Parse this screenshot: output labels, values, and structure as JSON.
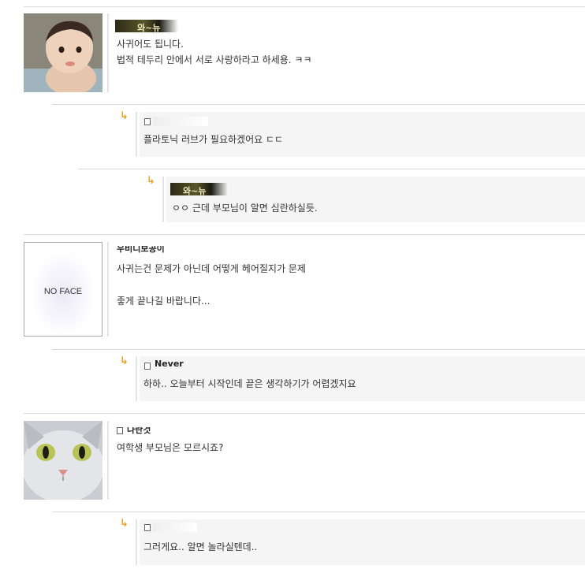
{
  "comments": [
    {
      "author": "와~뉴",
      "lines": [
        "사귀어도 됩니다.",
        "법적 테두리 안에서 서로 사랑하라고 하세용. ㅋㅋ"
      ],
      "replies": [
        {
          "author": "",
          "text": "플라토닉 러브가 필요하겠어요 ㄷㄷ"
        },
        {
          "author": "와~뉴",
          "text": "ㅇㅇ 근데 부모님이 알면 심란하실듯."
        }
      ]
    },
    {
      "author": "우비디보공이",
      "avatar_label": "NO FACE",
      "lines": [
        "사귀는건 문제가 아닌데 어떻게 헤어질지가 문제",
        "좋게 끝나길 바랍니다..."
      ],
      "replies": [
        {
          "author": "Never",
          "text": "하하.. 오늘부터 시작인데 끝은 생각하기가 어렵겠지요"
        }
      ]
    },
    {
      "author": "나란것",
      "lines": [
        "여학생 부모님은 모르시죠?"
      ],
      "replies": [
        {
          "author": "",
          "text": "그러게요.. 알면 놀라실텐데.."
        }
      ]
    }
  ],
  "colors": {
    "reply_arrow": "#e8a22a",
    "reply_bg": "#f5f5f5",
    "divider": "#dcdcdc"
  },
  "icons": [
    "reply-arrow-icon",
    "comment-icon"
  ]
}
